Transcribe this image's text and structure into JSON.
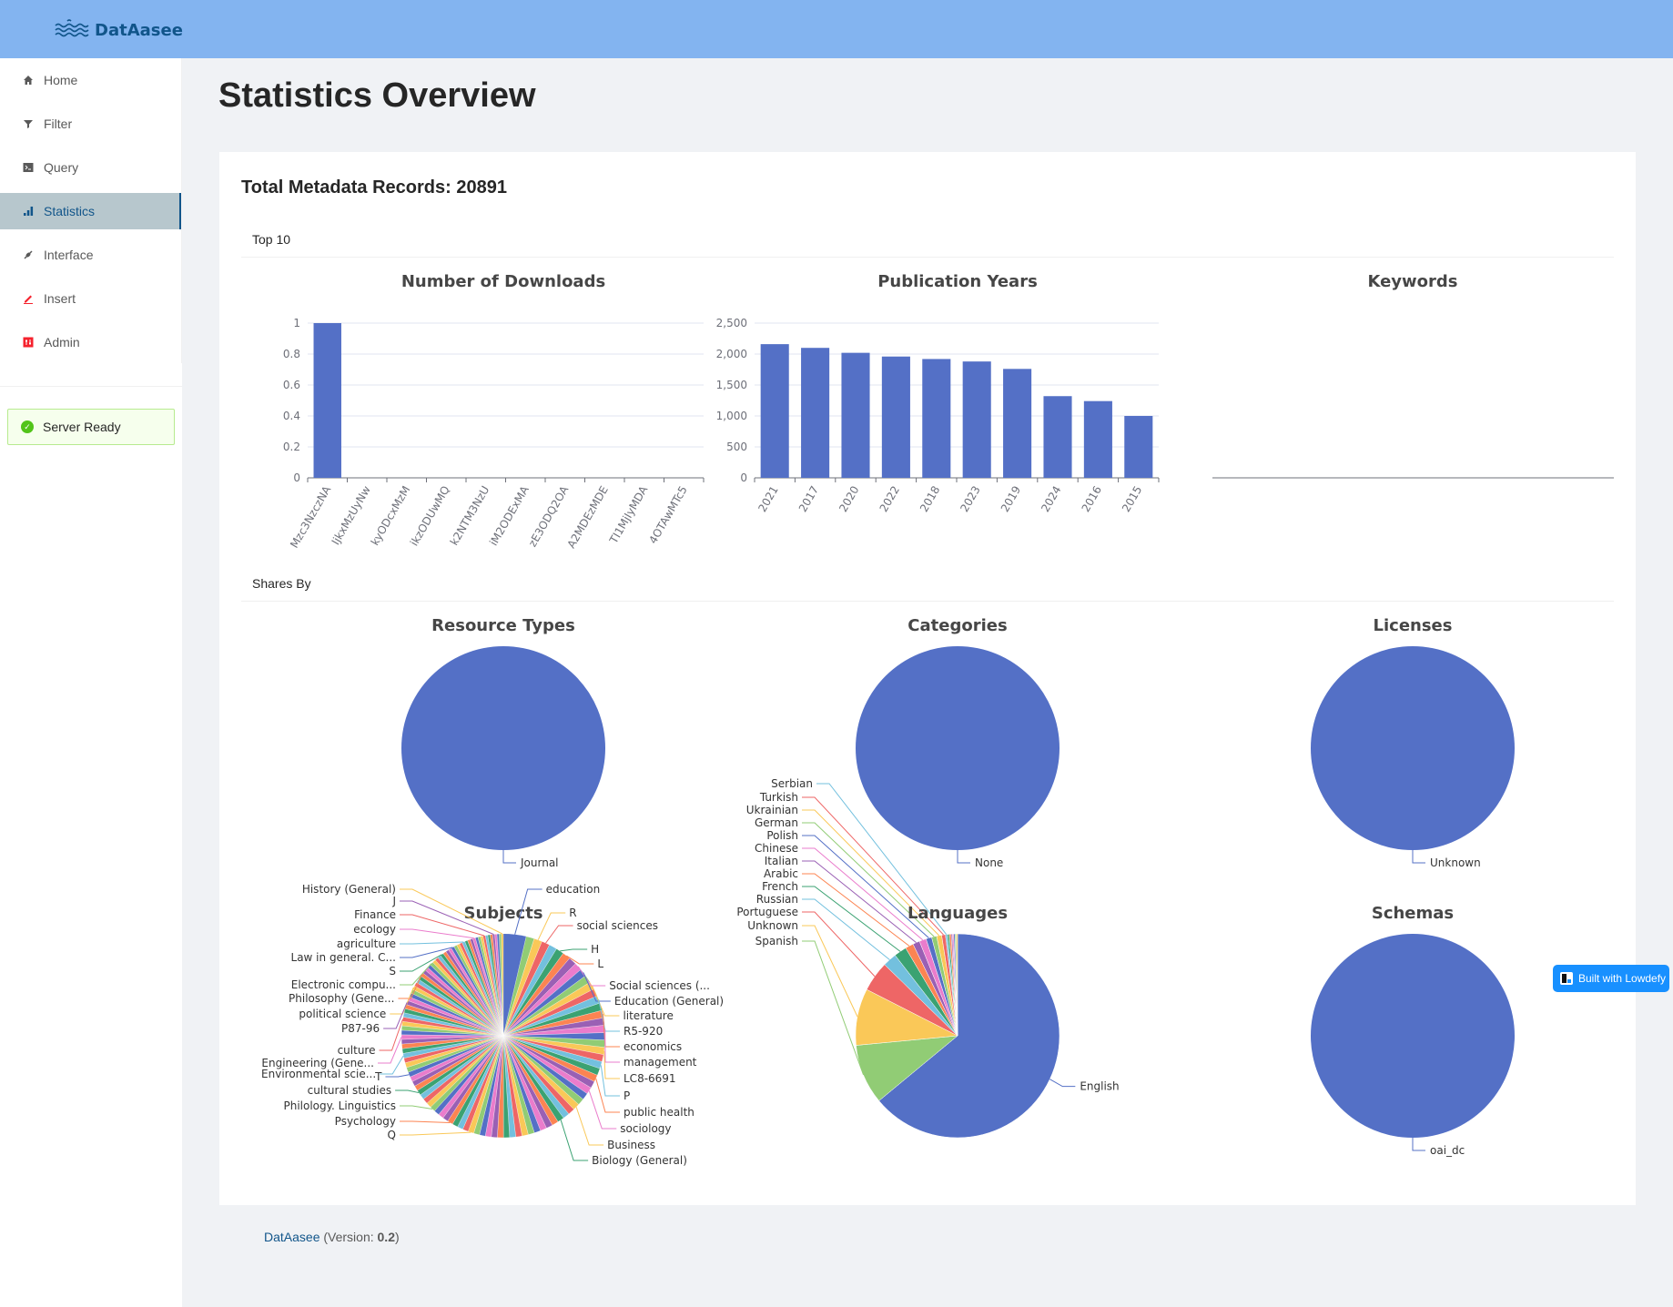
{
  "app": {
    "name": "DatAasee",
    "logo_icon": "waves-icon"
  },
  "sidebar": {
    "items": [
      {
        "label": "Home",
        "icon": "home-icon",
        "active": false
      },
      {
        "label": "Filter",
        "icon": "filter-icon",
        "active": false
      },
      {
        "label": "Query",
        "icon": "terminal-icon",
        "active": false
      },
      {
        "label": "Statistics",
        "icon": "bar-chart-icon",
        "active": true
      },
      {
        "label": "Interface",
        "icon": "api-plug-icon",
        "active": false
      },
      {
        "label": "Insert",
        "icon": "edit-icon",
        "active": false
      },
      {
        "label": "Admin",
        "icon": "control-icon",
        "active": false
      }
    ],
    "status": {
      "label": "Server Ready",
      "icon": "check-circle-icon",
      "color": "#52c41a"
    }
  },
  "page": {
    "title": "Statistics Overview"
  },
  "card": {
    "total_label": "Total Metadata Records: 20891",
    "section_top": "Top 10",
    "section_shares": "Shares By"
  },
  "colors": {
    "header": "#83b4f0",
    "brand": "#11558a",
    "palette": [
      "#5470c6",
      "#91cc75",
      "#fac858",
      "#ee6666",
      "#73c0de",
      "#3ba272",
      "#fc8452",
      "#9a60b4",
      "#ea7ccc"
    ]
  },
  "chart_data": [
    {
      "id": "downloads",
      "type": "bar",
      "title": "Number of Downloads",
      "categories": [
        "Mzc3NzczNA",
        "IjkxMzUyNw",
        "kyODcxMzM",
        "ikzODUwMQ",
        "k2NTM3NzU",
        "iM2ODExMA",
        "zE3ODQ2OA",
        "A2MDEzMDE",
        "TI1MjIyMDA",
        "4OTAwMTc5"
      ],
      "values": [
        1,
        0,
        0,
        0,
        0,
        0,
        0,
        0,
        0,
        0
      ],
      "yticks": [
        "0",
        "0.2",
        "0.4",
        "0.6",
        "0.8",
        "1"
      ],
      "ylim": [
        0,
        1
      ],
      "grid": true,
      "xlabel": "",
      "ylabel": ""
    },
    {
      "id": "years",
      "type": "bar",
      "title": "Publication Years",
      "categories": [
        "2021",
        "2017",
        "2020",
        "2022",
        "2018",
        "2023",
        "2019",
        "2024",
        "2016",
        "2015"
      ],
      "values": [
        2160,
        2100,
        2020,
        1960,
        1920,
        1880,
        1760,
        1320,
        1240,
        1000
      ],
      "yticks": [
        "0",
        "500",
        "1,000",
        "1,500",
        "2,000",
        "2,500"
      ],
      "ylim": [
        0,
        2500
      ],
      "grid": true,
      "xlabel": "",
      "ylabel": ""
    },
    {
      "id": "keywords",
      "type": "bar",
      "title": "Keywords",
      "categories": [],
      "values": []
    },
    {
      "id": "resource_types",
      "type": "pie",
      "title": "Resource Types",
      "slices": [
        {
          "label": "Journal",
          "value": 100
        }
      ]
    },
    {
      "id": "categories",
      "type": "pie",
      "title": "Categories",
      "slices": [
        {
          "label": "None",
          "value": 100
        }
      ]
    },
    {
      "id": "licenses",
      "type": "pie",
      "title": "Licenses",
      "slices": [
        {
          "label": "Unknown",
          "value": 100
        }
      ]
    },
    {
      "id": "subjects",
      "type": "pie",
      "title": "Subjects",
      "slices_count": 120,
      "first_slice_share": 3.6,
      "labeled_slices": {
        "right": [
          "education",
          "R",
          "social sciences",
          "H",
          "L",
          "Social sciences (...",
          "Education (General)",
          "literature",
          "R5-920",
          "economics",
          "management",
          "LC8-6691",
          "P",
          "public health",
          "sociology",
          "Business",
          "Biology (General)"
        ],
        "left": [
          "History (General)",
          "J",
          "Finance",
          "ecology",
          "agriculture",
          "Law in general. C...",
          "S",
          "Electronic compu...",
          "Philosophy (Gene...",
          "political science",
          "P87-96",
          "culture",
          "Engineering (Gene...",
          "Environmental scie...",
          "T",
          "cultural studies",
          "Philology. Linguistics",
          "Psychology",
          "Q"
        ]
      }
    },
    {
      "id": "languages",
      "type": "pie",
      "title": "Languages",
      "slices": [
        {
          "label": "English",
          "value": 64.0
        },
        {
          "label": "Spanish",
          "value": 9.5
        },
        {
          "label": "Unknown",
          "value": 9.0
        },
        {
          "label": "Portuguese",
          "value": 4.8
        },
        {
          "label": "Russian",
          "value": 2.2
        },
        {
          "label": "French",
          "value": 2.0
        },
        {
          "label": "Arabic",
          "value": 1.3
        },
        {
          "label": "Italian",
          "value": 1.1
        },
        {
          "label": "Chinese",
          "value": 1.1
        },
        {
          "label": "Polish",
          "value": 0.9
        },
        {
          "label": "German",
          "value": 0.8
        },
        {
          "label": "Ukrainian",
          "value": 0.8
        },
        {
          "label": "Turkish",
          "value": 0.6
        },
        {
          "label": "Serbian",
          "value": 0.3
        },
        {
          "label": "",
          "value": 0.3
        },
        {
          "label": "",
          "value": 0.3
        },
        {
          "label": "",
          "value": 0.2
        },
        {
          "label": "",
          "value": 0.2
        },
        {
          "label": "",
          "value": 0.2
        },
        {
          "label": "",
          "value": 0.2
        },
        {
          "label": "",
          "value": 0.2
        }
      ]
    },
    {
      "id": "schemas",
      "type": "pie",
      "title": "Schemas",
      "slices": [
        {
          "label": "oai_dc",
          "value": 100
        }
      ]
    }
  ],
  "footer": {
    "link": "DatAasee",
    "version_prefix": " (Version: ",
    "version": "0.2",
    "version_suffix": ")"
  },
  "badge": {
    "label": "Built with Lowdefy",
    "icon": "lowdefy-logo-icon"
  }
}
